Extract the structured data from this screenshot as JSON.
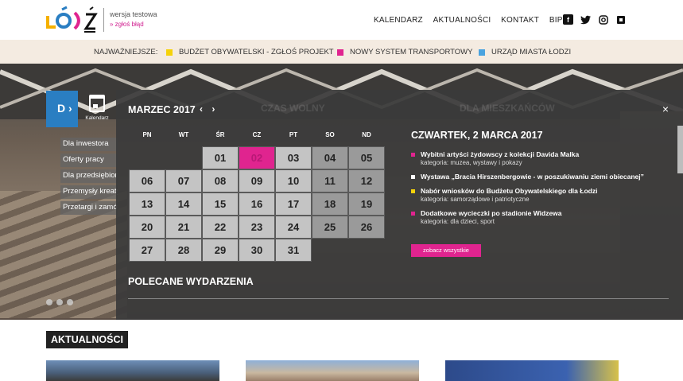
{
  "header": {
    "beta_label": "wersja testowa",
    "report_label": "» zgłoś błąd",
    "nav": [
      "KALENDARZ",
      "AKTUALNOŚCI",
      "KONTAKT",
      "BIP"
    ],
    "social": [
      "facebook-icon",
      "twitter-icon",
      "instagram-icon",
      "square-icon"
    ]
  },
  "highlights": {
    "label": "NAJWAŻNIEJSZE:",
    "items": [
      {
        "text": "BUDŻET OBYWATELSKI - ZGŁOŚ PROJEKT",
        "color": "#f5d20a"
      },
      {
        "text": "NOWY SYSTEM TRANSPORTOWY",
        "color": "#e0248f"
      },
      {
        "text": "URZĄD MIASTA ŁODZI",
        "color": "#4aa3df"
      }
    ]
  },
  "side": {
    "d_label": "D",
    "links": [
      "Dla inwestora",
      "Oferty pracy",
      "Dla przedsiębiorców",
      "Przemysły kreatywne",
      "Przetargi i zamówienia"
    ]
  },
  "calendar": {
    "icon_label": "Kalendarz",
    "month_title": "MARZEC 2017",
    "prev": "‹",
    "next": "›",
    "close": "×",
    "ghost_titles": [
      "CZAS WOLNY",
      "DLA MIESZKAŃCÓW"
    ],
    "weekdays": [
      "PN",
      "WT",
      "ŚR",
      "CZ",
      "PT",
      "SO",
      "ND"
    ],
    "leading_empty": 2,
    "days": [
      "01",
      "02",
      "03",
      "04",
      "05",
      "06",
      "07",
      "08",
      "09",
      "10",
      "11",
      "12",
      "13",
      "14",
      "15",
      "16",
      "17",
      "18",
      "19",
      "20",
      "21",
      "22",
      "23",
      "24",
      "25",
      "26",
      "27",
      "28",
      "29",
      "30",
      "31"
    ],
    "selected_day": "02",
    "weekend_dark": [
      "04",
      "05",
      "11",
      "12",
      "18",
      "19",
      "25",
      "26"
    ],
    "selected_date_heading": "CZWARTEK, 2 MARCA 2017",
    "events": [
      {
        "title": "Wybitni artyści żydowscy z kolekcji Davida Malka",
        "category": "kategoria: muzea, wystawy i pokazy",
        "color": "#e0248f"
      },
      {
        "title": "Wystawa „Bracia Hirszenbergowie - w poszukiwaniu ziemi obiecanej”",
        "category": "",
        "color": "#ffffff"
      },
      {
        "title": "Nabór wniosków do Budżetu Obywatelskiego dla Łodzi",
        "category": "kategoria: samorządowe i patriotyczne",
        "color": "#f5d20a"
      },
      {
        "title": "Dodatkowe wycieczki po stadionie Widzewa",
        "category": "kategoria: dla dzieci, sport",
        "color": "#e0248f"
      }
    ],
    "see_all_label": "zobacz wszystkie",
    "recommended_label": "POLECANE WYDARZENIA"
  },
  "news": {
    "title": "AKTUALNOŚCI"
  }
}
